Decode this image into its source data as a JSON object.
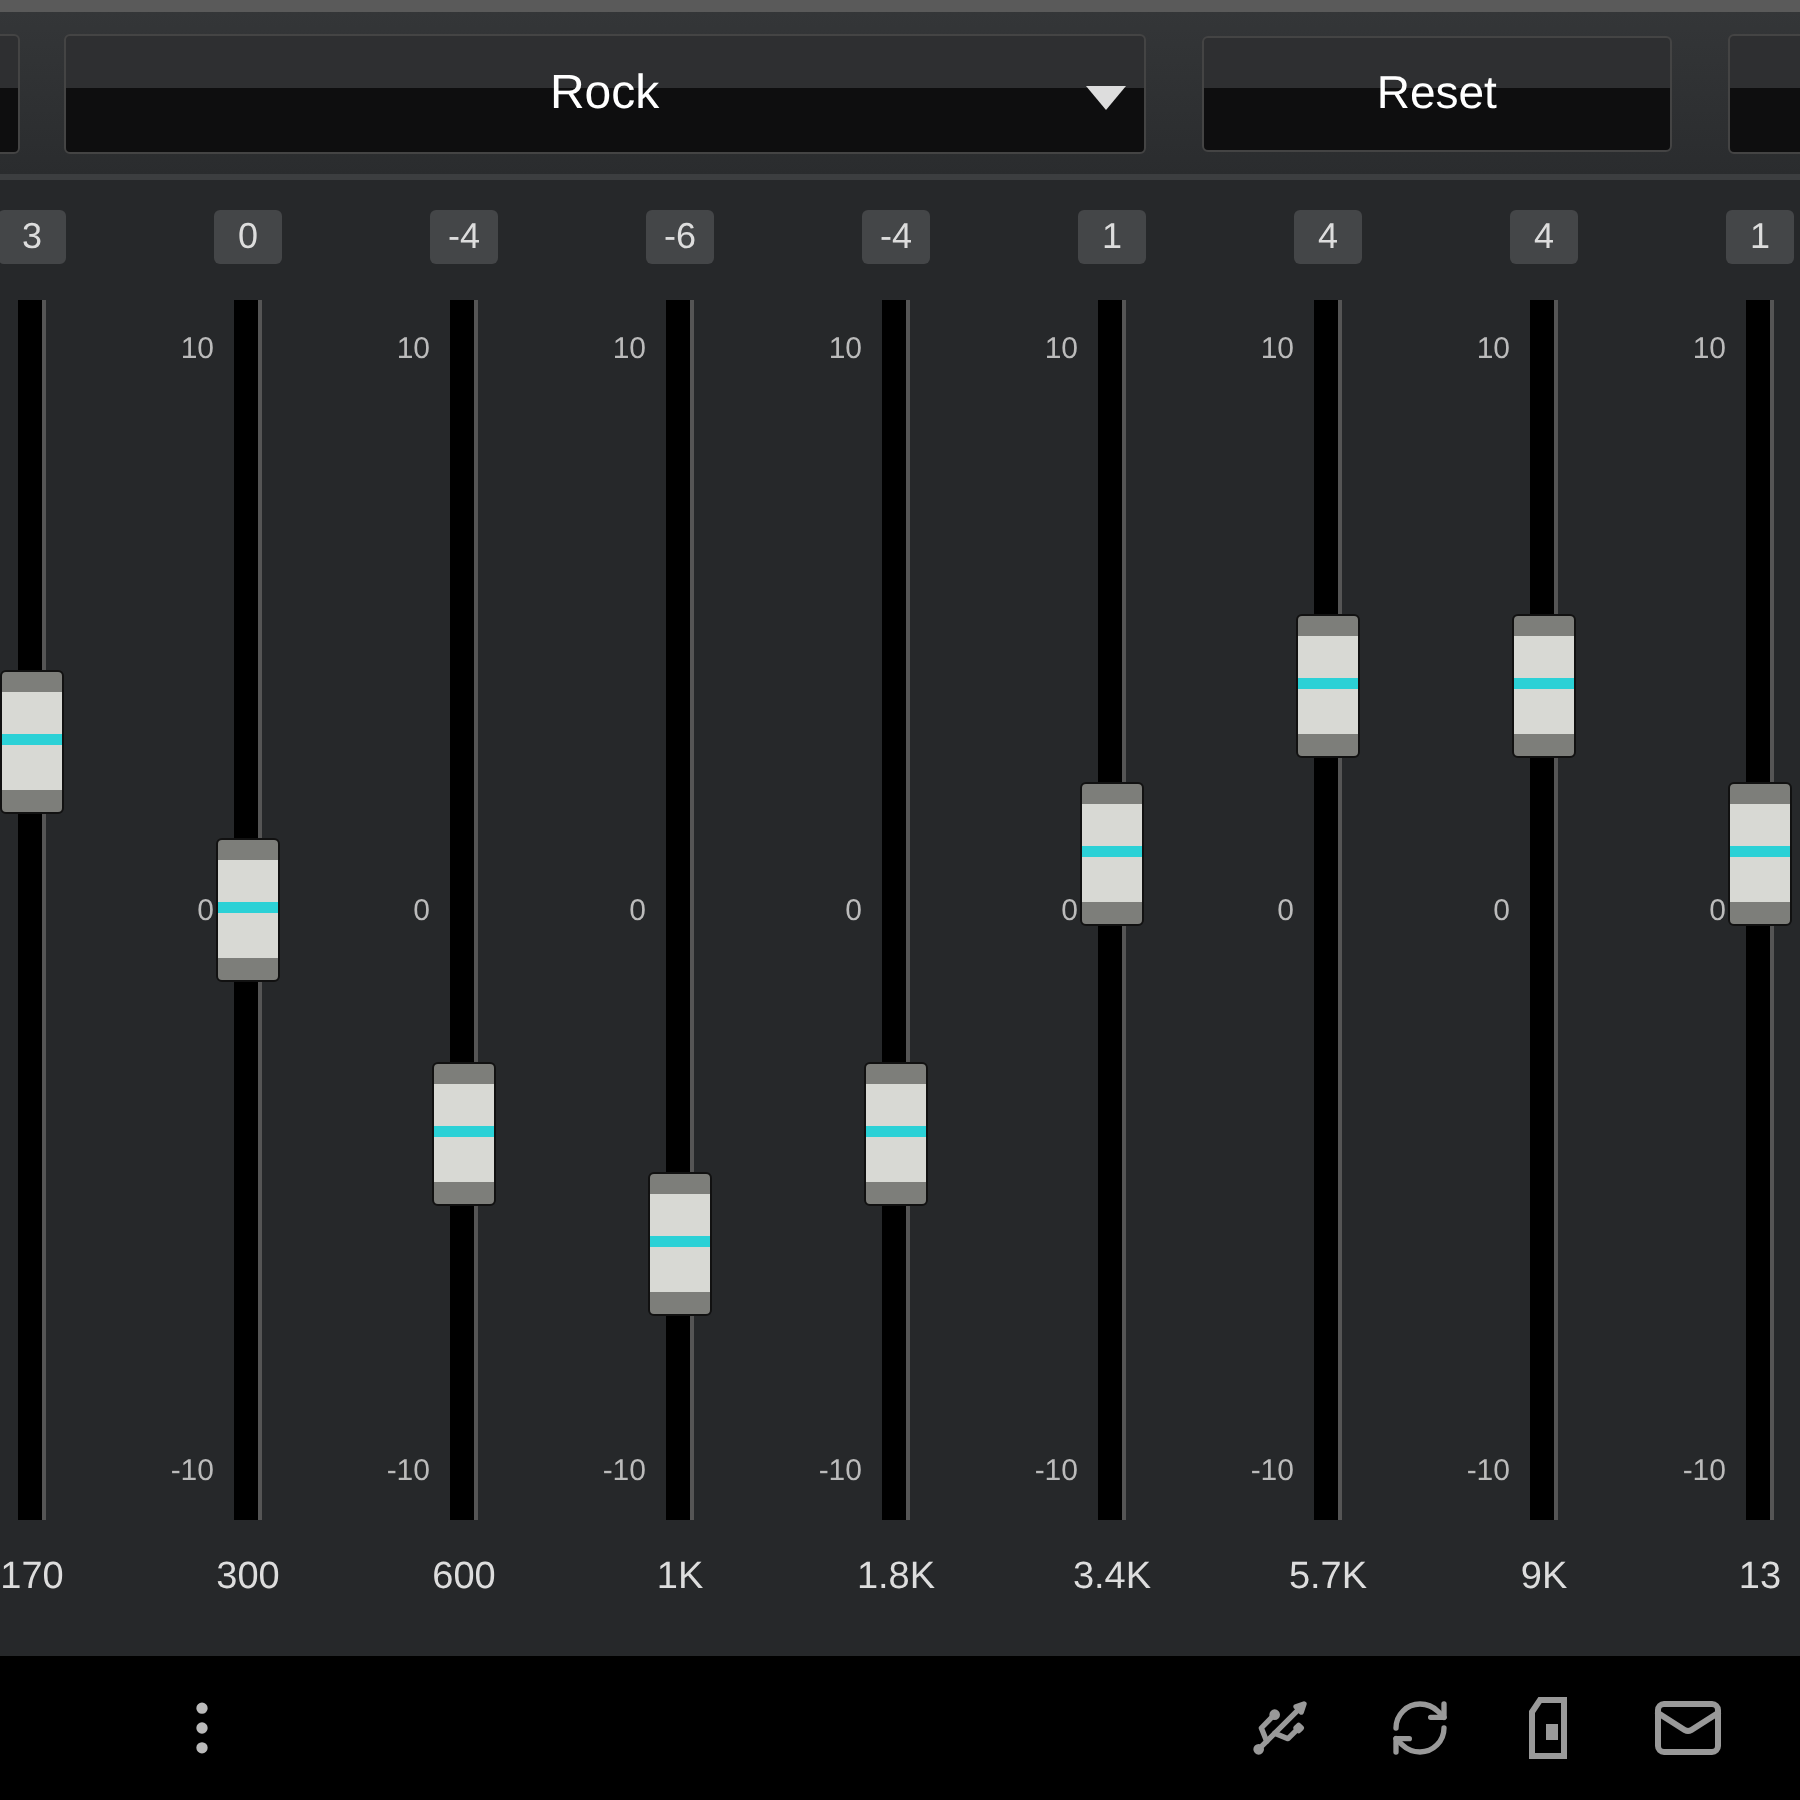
{
  "preset": {
    "label": "Rock"
  },
  "reset_button": {
    "label": "Reset"
  },
  "bands": [
    {
      "value": "3",
      "freq": "170",
      "level": 0.65
    },
    {
      "value": "0",
      "freq": "300",
      "level": 0.5,
      "scale": [
        "10",
        "0",
        "-10"
      ]
    },
    {
      "value": "-4",
      "freq": "600",
      "level": 0.3,
      "scale": [
        "10",
        "0",
        "-10"
      ]
    },
    {
      "value": "-6",
      "freq": "1K",
      "level": 0.2,
      "scale": [
        "10",
        "0",
        "-10"
      ]
    },
    {
      "value": "-4",
      "freq": "1.8K",
      "level": 0.3,
      "scale": [
        "10",
        "0",
        "-10"
      ]
    },
    {
      "value": "1",
      "freq": "3.4K",
      "level": 0.55,
      "scale": [
        "10",
        "0",
        "-10"
      ]
    },
    {
      "value": "4",
      "freq": "5.7K",
      "level": 0.7,
      "scale": [
        "10",
        "0",
        "-10"
      ]
    },
    {
      "value": "4",
      "freq": "9K",
      "level": 0.7,
      "scale": [
        "10",
        "0",
        "-10"
      ]
    },
    {
      "value": "1",
      "freq": "13",
      "level": 0.55,
      "scale": [
        "10",
        "0",
        "-10"
      ]
    }
  ]
}
